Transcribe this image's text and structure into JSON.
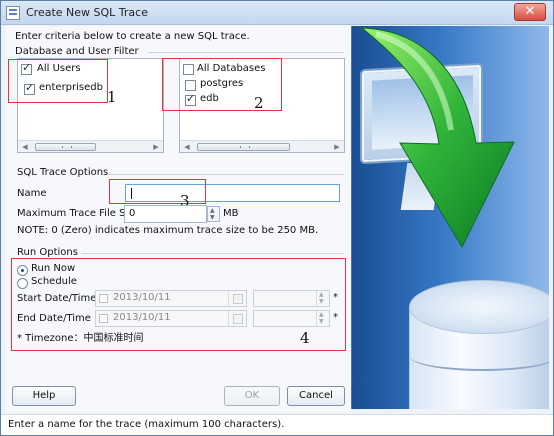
{
  "window": {
    "title": "Create New SQL Trace",
    "close_glyph": "✕"
  },
  "dialog": {
    "intro": "Enter criteria below to create a new SQL trace."
  },
  "db_user_filter": {
    "section_label": "Database and User Filter",
    "all_users_label": "All Users",
    "all_users_checked": true,
    "users": [
      {
        "label": "enterprisedb",
        "checked": true
      }
    ],
    "all_databases_label": "All Databases",
    "all_databases_checked": false,
    "databases": [
      {
        "label": "postgres",
        "checked": false
      },
      {
        "label": "edb",
        "checked": true
      }
    ]
  },
  "sql_trace_options": {
    "section_label": "SQL Trace Options",
    "name_label": "Name",
    "name_value": "",
    "max_size_label": "Maximum Trace File Size",
    "max_size_value": "0",
    "max_size_unit": "MB",
    "note": "NOTE: 0 (Zero) indicates maximum trace size to be 250 MB."
  },
  "run_options": {
    "section_label": "Run Options",
    "run_now_label": "Run Now",
    "schedule_label": "Schedule",
    "selected": "Run Now",
    "start_label": "Start Date/Time",
    "start_date": "2013/10/11",
    "end_label": "End Date/Time",
    "end_date": "2013/10/11",
    "required_mark": "*",
    "timezone": "* Timezone：中国标准时间"
  },
  "annotations": {
    "one": "1",
    "two": "2",
    "three": "3",
    "four": "4"
  },
  "buttons": {
    "help": "Help",
    "ok": "OK",
    "cancel": "Cancel"
  },
  "status": {
    "text": "Enter a name for the trace (maximum 100 characters)."
  },
  "colors": {
    "annotation_red": "#e53636",
    "hero_blue": "#2d67b1",
    "arrow_green": "#31b43a"
  }
}
